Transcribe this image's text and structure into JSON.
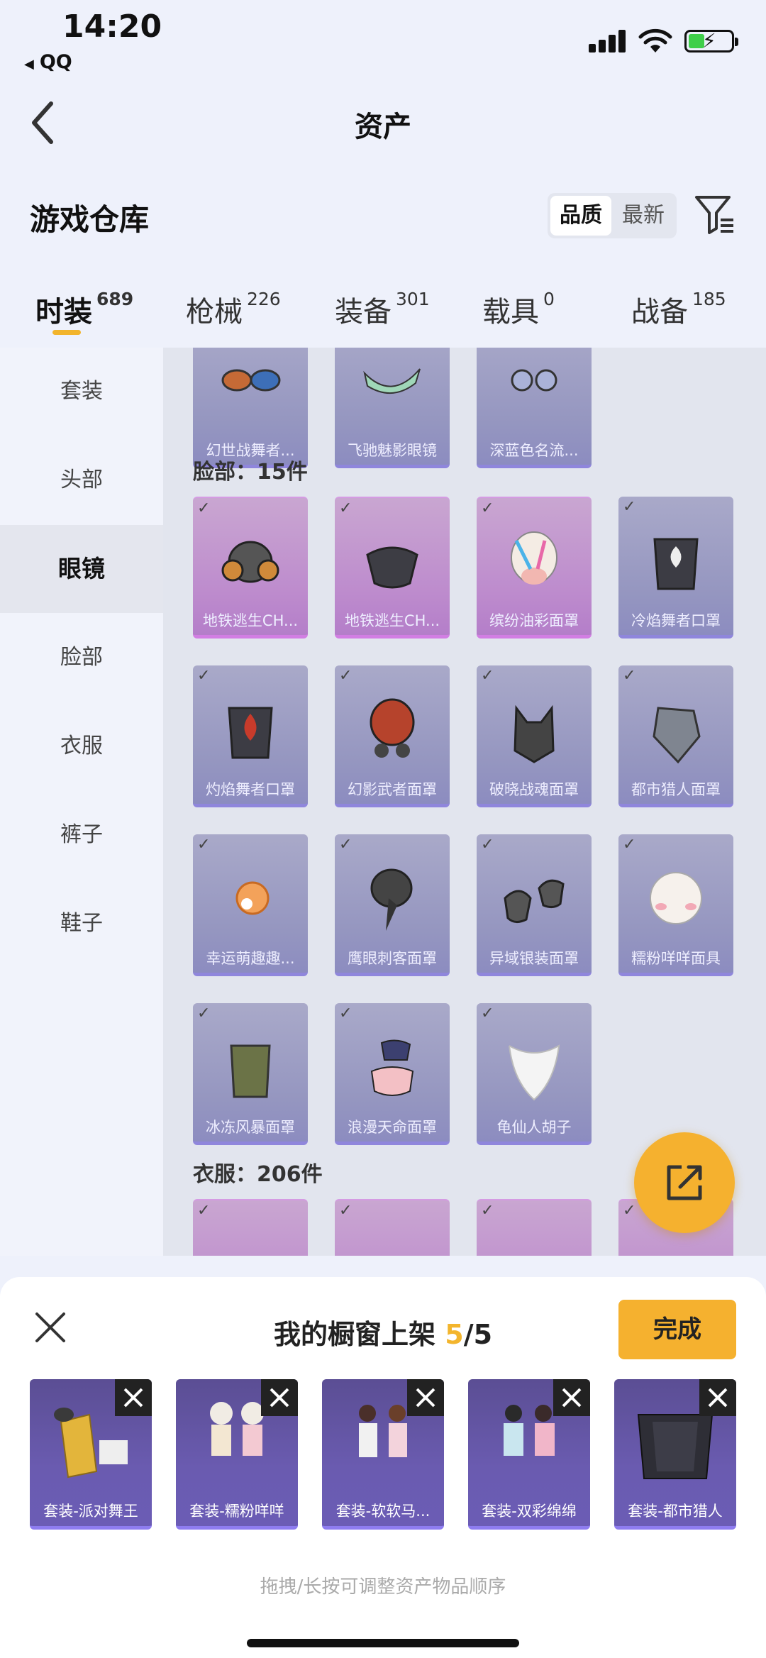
{
  "status_bar": {
    "time": "14:20",
    "back_app": "QQ"
  },
  "navbar": {
    "title": "资产"
  },
  "warehouse": {
    "title": "游戏仓库",
    "sort_options": [
      "品质",
      "最新"
    ],
    "active_sort": "品质"
  },
  "tabs": [
    {
      "label": "时装",
      "count": "689",
      "active": true
    },
    {
      "label": "枪械",
      "count": "226"
    },
    {
      "label": "装备",
      "count": "301"
    },
    {
      "label": "载具",
      "count": "0"
    },
    {
      "label": "战备",
      "count": "185"
    }
  ],
  "sidebar": {
    "items": [
      {
        "label": "套装"
      },
      {
        "label": "头部"
      },
      {
        "label": "眼镜",
        "active": true
      },
      {
        "label": "脸部"
      },
      {
        "label": "衣服"
      },
      {
        "label": "裤子"
      },
      {
        "label": "鞋子"
      }
    ]
  },
  "content": {
    "glasses_row": [
      "幻世战舞者...",
      "飞驰魅影眼镜",
      "深蓝色名流..."
    ],
    "face_section_title": "脸部：15件",
    "face_items": [
      {
        "label": "地铁逃生CH...",
        "rarity": "pink"
      },
      {
        "label": "地铁逃生CH...",
        "rarity": "pink"
      },
      {
        "label": "缤纷油彩面罩",
        "rarity": "pink"
      },
      {
        "label": "冷焰舞者口罩",
        "rarity": "purple"
      },
      {
        "label": "灼焰舞者口罩",
        "rarity": "purple"
      },
      {
        "label": "幻影武者面罩",
        "rarity": "purple"
      },
      {
        "label": "破晓战魂面罩",
        "rarity": "purple"
      },
      {
        "label": "都市猎人面罩",
        "rarity": "purple"
      },
      {
        "label": "幸运萌趣趣...",
        "rarity": "purple"
      },
      {
        "label": "鹰眼刺客面罩",
        "rarity": "purple"
      },
      {
        "label": "异域银装面罩",
        "rarity": "purple"
      },
      {
        "label": "糯粉咩咩面具",
        "rarity": "purple"
      },
      {
        "label": "冰冻风暴面罩",
        "rarity": "purple"
      },
      {
        "label": "浪漫天命面罩",
        "rarity": "purple"
      },
      {
        "label": "龟仙人胡子",
        "rarity": "purple"
      }
    ],
    "clothes_section_title": "衣服：206件"
  },
  "sheet": {
    "title_prefix": "我的橱窗上架",
    "current": "5",
    "total": "/5",
    "done_label": "完成",
    "slots": [
      {
        "label": "套装-派对舞王"
      },
      {
        "label": "套装-糯粉咩咩"
      },
      {
        "label": "套装-软软马..."
      },
      {
        "label": "套装-双彩绵绵"
      },
      {
        "label": "套装-都市猎人"
      }
    ],
    "hint": "拖拽/长按可调整资产物品顺序"
  },
  "colors": {
    "accent": "#f5b12f",
    "rare_purple": "#8f86dc",
    "rare_pink": "#d27ee3"
  }
}
